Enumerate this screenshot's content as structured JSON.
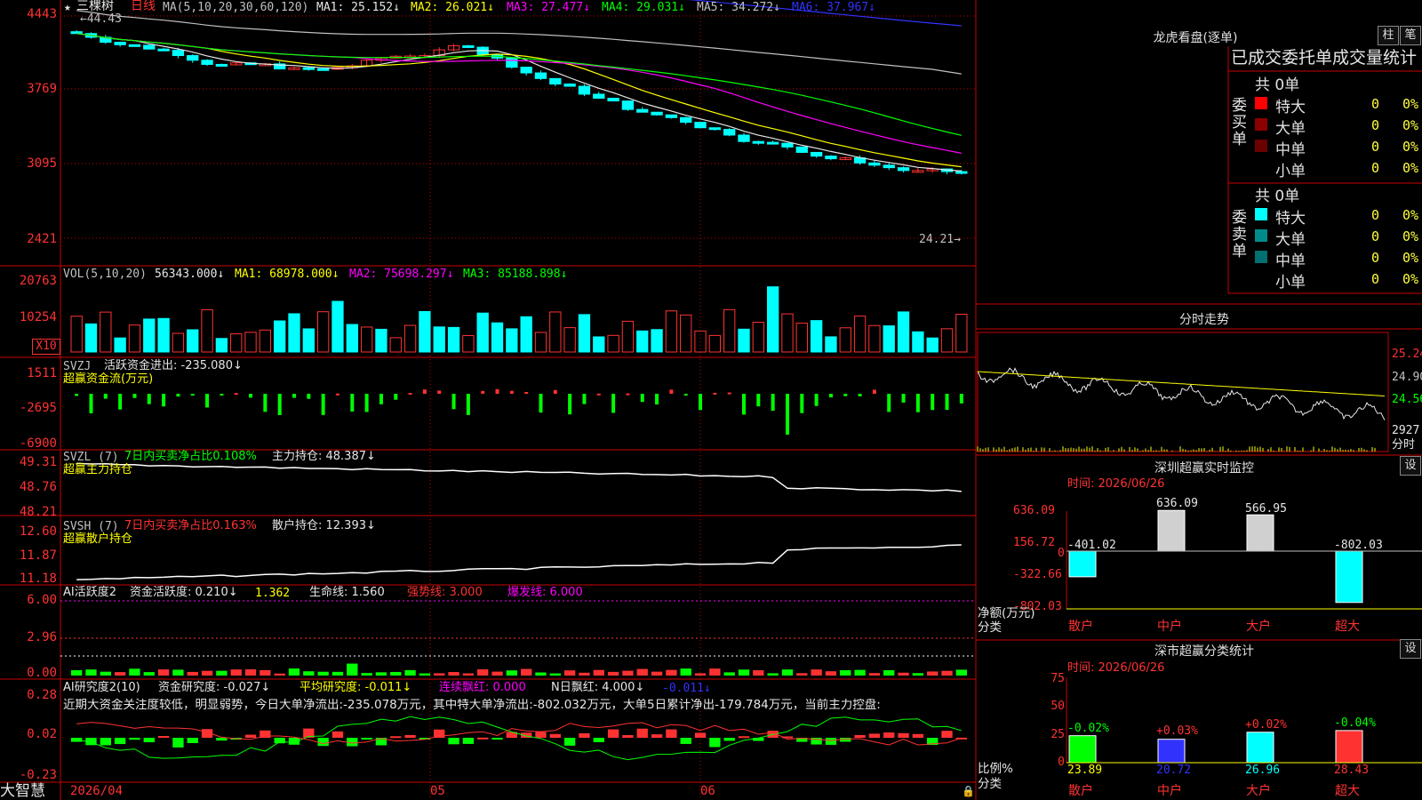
{
  "header": {
    "marker": "★",
    "stock_name": "三棵树",
    "period": "日线",
    "ma_params": "MA(5,10,20,30,60,120)",
    "ma1": "MA1: 25.152↓",
    "ma2": "MA2: 26.021↓",
    "ma3": "MA3: 27.477↓",
    "ma4": "MA4: 29.031↓",
    "ma5": "MA5: 34.272↓",
    "ma6": "MA6: 37.967↓",
    "high_mark": "←44.43",
    "low_mark": "24.21→"
  },
  "price_axis": [
    "4443",
    "3769",
    "3095",
    "2421"
  ],
  "vol": {
    "title": "VOL(5,10,20)",
    "val": "56343.000↓",
    "ma1": "MA1: 68978.000↓",
    "ma2": "MA2: 75698.297↓",
    "ma3": "MA3: 85188.898↓",
    "axis": [
      "20763",
      "10254"
    ],
    "unit": "X10"
  },
  "svzj": {
    "title": "SVZJ",
    "label": "活跃资金进出: -235.080↓",
    "sub": "超赢资金流(万元)",
    "axis": [
      "1511",
      "-2695",
      "-6900"
    ]
  },
  "svzl": {
    "title": "SVZL (7)",
    "label1": "7日内买卖净占比0.108%",
    "label2": "主力持仓: 48.387↓",
    "sub": "超赢主力持仓",
    "axis": [
      "49.31",
      "48.76",
      "48.21"
    ]
  },
  "svsh": {
    "title": "SVSH (7)",
    "label1": "7日内买卖净占比0.163%",
    "label2": "散户持仓: 12.393↓",
    "sub": "超赢散户持仓",
    "axis": [
      "12.60",
      "11.87",
      "11.18"
    ]
  },
  "ai1": {
    "title": "AI活跃度2",
    "a": "资金活跃度: 0.210↓",
    "b": "1.362",
    "c": "生命线: 1.560",
    "d": "强势线: 3.000",
    "e": "爆发线: 6.000",
    "axis": [
      "6.00",
      "2.96",
      "0.00"
    ]
  },
  "ai2": {
    "title": "AI研究度2(10)",
    "a": "资金研究度: -0.027↓",
    "b": "平均研究度: -0.011↓",
    "c": "连续飘红: 0.000",
    "d": "N日飘红: 4.000↓",
    "e": "-0.011↓",
    "text": "近期大资金关注度较低，明显弱势，今日大单净流出:-235.078万元，其中特大单净流出:-802.032万元，大单5日累计净出-179.784万元，当前主力控盘:",
    "axis": [
      "0.28",
      "0.02",
      "-0.23"
    ]
  },
  "bottom": {
    "brand": "大智慧",
    "dates": [
      "2026/04",
      "05",
      "06"
    ]
  },
  "longhu": {
    "title": "龙虎看盘(逐单)",
    "btn1": "柱",
    "btn2": "笔",
    "tabs": "已成交委托单成交量统计",
    "buy_label": "委买单",
    "sell_label": "委卖单",
    "buy_total": "共 0单",
    "sell_total": "共 0单",
    "rows": [
      {
        "label": "特大",
        "count": "0",
        "pct": "0%"
      },
      {
        "label": "大单",
        "count": "0",
        "pct": "0%"
      },
      {
        "label": "中单",
        "count": "0",
        "pct": "0%"
      },
      {
        "label": "小单",
        "count": "0",
        "pct": "0%"
      }
    ],
    "buy_colors": [
      "#ff0000",
      "#8b0000",
      "#6b0000",
      "#000000"
    ],
    "sell_colors": [
      "#00ffff",
      "#008b8b",
      "#007070",
      "#000000"
    ]
  },
  "fenshi": {
    "title": "分时走势",
    "axis": [
      "25.24",
      "24.90",
      "24.56",
      "2927",
      "分时"
    ]
  },
  "monitor": {
    "title": "深圳超赢实时监控",
    "btn": "设",
    "time": "时间: 2026/06/26",
    "axis": [
      "636.09",
      "156.72",
      "0",
      "-322.66",
      "-802.03"
    ],
    "ylabel": "净额(万元)",
    "xlabel": "分类",
    "cats": [
      "散户",
      "中户",
      "大户",
      "超大"
    ],
    "values": [
      -401.02,
      636.09,
      566.95,
      -802.03
    ],
    "value_labels": [
      "-401.02",
      "636.09",
      "566.95",
      "-802.03"
    ]
  },
  "classify": {
    "title": "深市超赢分类统计",
    "btn": "设",
    "time": "时间: 2026/06/26",
    "axis": [
      "75",
      "50",
      "25",
      "0"
    ],
    "ylabel": "比例%",
    "xlabel": "分类",
    "cats": [
      "散户",
      "中户",
      "大户",
      "超大"
    ],
    "changes": [
      "-0.02%",
      "+0.03%",
      "+0.02%",
      "-0.04%"
    ],
    "values": [
      "23.89",
      "20.72",
      "26.96",
      "28.43"
    ]
  },
  "colors": {
    "up": "#ff3232",
    "down": "#00ffff",
    "grid": "#c80000",
    "text": "#c0c0c0",
    "yellow": "#ffff00",
    "green": "#00ff00",
    "magenta": "#ff00ff"
  }
}
